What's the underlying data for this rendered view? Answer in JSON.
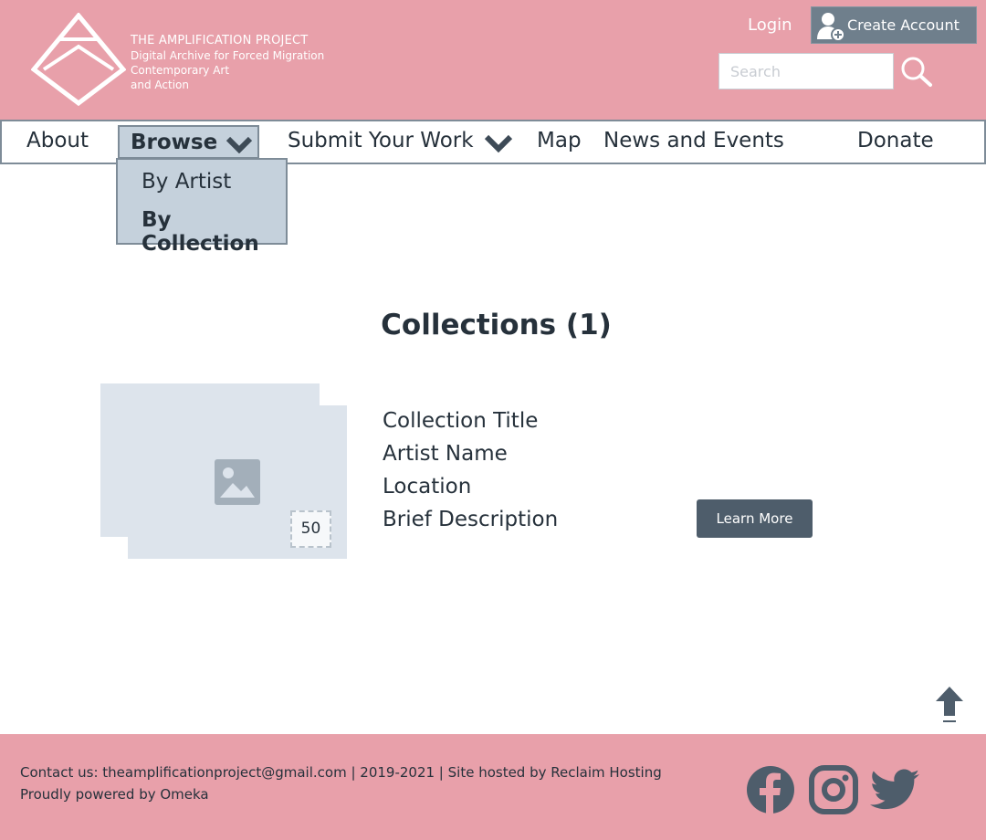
{
  "brand": {
    "line1": "THE AMPLIFICATION PROJECT",
    "line2": "Digital Archive for Forced Migration",
    "line3": "Contemporary Art",
    "line4": "and Action",
    "logo_text": "THE AMPLIFICATION PROJECT"
  },
  "header": {
    "login": "Login",
    "create_account": "Create Account",
    "search_placeholder": "Search",
    "search_value": ""
  },
  "nav": {
    "about": "About",
    "browse": "Browse",
    "submit": "Submit Your Work",
    "map": "Map",
    "news": "News and Events",
    "donate": "Donate",
    "browse_menu": [
      "By Artist",
      "By Collection"
    ]
  },
  "main": {
    "heading": "Collections (1)",
    "collection": {
      "count": "50",
      "title": "Collection Title",
      "artist": "Artist Name",
      "location": "Location",
      "description": "Brief Description",
      "learn_more": "Learn More"
    }
  },
  "footer": {
    "line1": "Contact us: theamplificationproject@gmail.com | 2019-2021 | Site hosted by Reclaim Hosting",
    "line2": "Proudly powered by Omeka"
  },
  "colors": {
    "header_bg": "#e8a0aa",
    "nav_active": "#c5d1dc",
    "button_dark": "#4e5d6b",
    "text_dark": "#26313b"
  },
  "icons": [
    "logo-icon",
    "user-add-icon",
    "search-icon",
    "chevron-down-icon",
    "image-placeholder-icon",
    "arrow-up-icon",
    "facebook-icon",
    "instagram-icon",
    "twitter-icon"
  ]
}
